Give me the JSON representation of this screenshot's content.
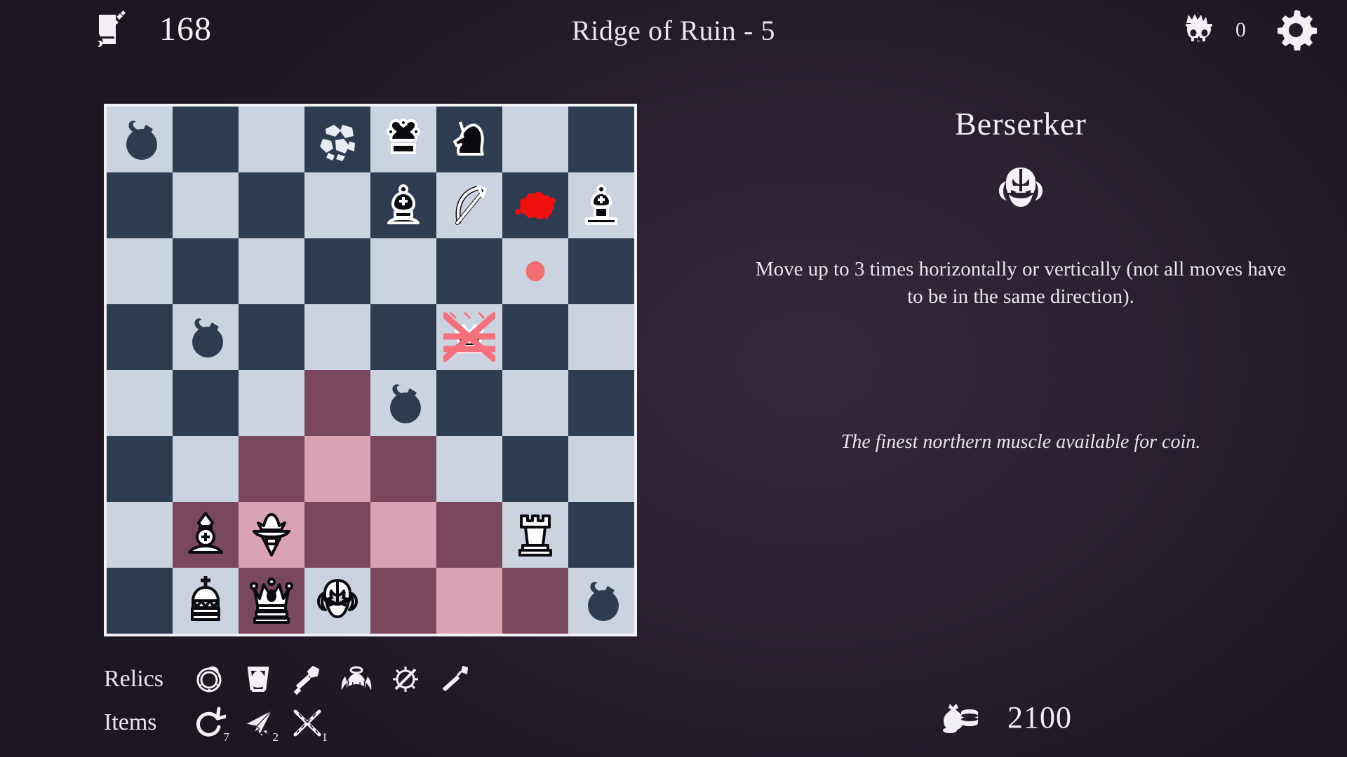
{
  "topbar": {
    "quest_icon": "scroll-icon",
    "quest_count": "168",
    "title": "Ridge of Ruin - 5",
    "skull_icon": "crowned-skull-icon",
    "skull_count": "0",
    "settings_icon": "gear-icon"
  },
  "board": {
    "files": [
      "a",
      "b",
      "c",
      "d",
      "e",
      "f",
      "g",
      "h"
    ],
    "colors": {
      "light": "#ccd3e0",
      "dark": "#2e3c52",
      "highlight_light": "#d9a3b4",
      "highlight_dark": "#79485c",
      "border": "#f2f1f6",
      "blood": "#f01010",
      "dot": "#f07070",
      "chain": "#f4707c"
    },
    "squares": [
      {
        "file": "a",
        "rank": 1,
        "shade": "light",
        "piece": "bomb"
      },
      {
        "file": "b",
        "rank": 1,
        "shade": "dark",
        "piece": null
      },
      {
        "file": "c",
        "rank": 1,
        "shade": "light",
        "piece": null
      },
      {
        "file": "d",
        "rank": 1,
        "shade": "dark",
        "piece": "rubble"
      },
      {
        "file": "e",
        "rank": 1,
        "shade": "light",
        "piece": "black-jester"
      },
      {
        "file": "f",
        "rank": 1,
        "shade": "dark",
        "piece": "black-unicorn"
      },
      {
        "file": "g",
        "rank": 1,
        "shade": "light",
        "piece": null
      },
      {
        "file": "h",
        "rank": 1,
        "shade": "dark",
        "piece": null
      },
      {
        "file": "a",
        "rank": 2,
        "shade": "dark",
        "piece": null
      },
      {
        "file": "b",
        "rank": 2,
        "shade": "light",
        "piece": null
      },
      {
        "file": "c",
        "rank": 2,
        "shade": "dark",
        "piece": null
      },
      {
        "file": "d",
        "rank": 2,
        "shade": "light",
        "piece": null
      },
      {
        "file": "e",
        "rank": 2,
        "shade": "dark",
        "piece": "black-bishop"
      },
      {
        "file": "f",
        "rank": 2,
        "shade": "light",
        "piece": "bow"
      },
      {
        "file": "g",
        "rank": 2,
        "shade": "dark",
        "piece": "blood-splat"
      },
      {
        "file": "h",
        "rank": 2,
        "shade": "light",
        "piece": "black-pawn"
      },
      {
        "file": "a",
        "rank": 3,
        "shade": "light",
        "piece": null
      },
      {
        "file": "b",
        "rank": 3,
        "shade": "dark",
        "piece": null
      },
      {
        "file": "c",
        "rank": 3,
        "shade": "light",
        "piece": null
      },
      {
        "file": "d",
        "rank": 3,
        "shade": "dark",
        "piece": null
      },
      {
        "file": "e",
        "rank": 3,
        "shade": "light",
        "piece": null
      },
      {
        "file": "f",
        "rank": 3,
        "shade": "dark",
        "piece": null
      },
      {
        "file": "g",
        "rank": 3,
        "shade": "light",
        "piece": "red-dot"
      },
      {
        "file": "h",
        "rank": 3,
        "shade": "dark",
        "piece": null
      },
      {
        "file": "a",
        "rank": 4,
        "shade": "dark",
        "piece": null
      },
      {
        "file": "b",
        "rank": 4,
        "shade": "light",
        "piece": "bomb"
      },
      {
        "file": "c",
        "rank": 4,
        "shade": "dark",
        "piece": null
      },
      {
        "file": "d",
        "rank": 4,
        "shade": "light",
        "piece": null
      },
      {
        "file": "e",
        "rank": 4,
        "shade": "dark",
        "piece": null
      },
      {
        "file": "f",
        "rank": 4,
        "shade": "light",
        "piece": "chained-black-queen"
      },
      {
        "file": "g",
        "rank": 4,
        "shade": "dark",
        "piece": null
      },
      {
        "file": "h",
        "rank": 4,
        "shade": "light",
        "piece": null
      },
      {
        "file": "a",
        "rank": 5,
        "shade": "light",
        "piece": null
      },
      {
        "file": "b",
        "rank": 5,
        "shade": "dark",
        "piece": null
      },
      {
        "file": "c",
        "rank": 5,
        "shade": "light",
        "piece": null
      },
      {
        "file": "d",
        "rank": 5,
        "shade": "hl-dark",
        "piece": null
      },
      {
        "file": "e",
        "rank": 5,
        "shade": "light",
        "piece": "bomb"
      },
      {
        "file": "f",
        "rank": 5,
        "shade": "dark",
        "piece": null
      },
      {
        "file": "g",
        "rank": 5,
        "shade": "light",
        "piece": null
      },
      {
        "file": "h",
        "rank": 5,
        "shade": "dark",
        "piece": null
      },
      {
        "file": "a",
        "rank": 6,
        "shade": "dark",
        "piece": null
      },
      {
        "file": "b",
        "rank": 6,
        "shade": "light",
        "piece": null
      },
      {
        "file": "c",
        "rank": 6,
        "shade": "hl-dark",
        "piece": null
      },
      {
        "file": "d",
        "rank": 6,
        "shade": "hl-light",
        "piece": null
      },
      {
        "file": "e",
        "rank": 6,
        "shade": "hl-dark",
        "piece": null
      },
      {
        "file": "f",
        "rank": 6,
        "shade": "light",
        "piece": null
      },
      {
        "file": "g",
        "rank": 6,
        "shade": "dark",
        "piece": null
      },
      {
        "file": "h",
        "rank": 6,
        "shade": "light",
        "piece": null
      },
      {
        "file": "a",
        "rank": 7,
        "shade": "light",
        "piece": null
      },
      {
        "file": "b",
        "rank": 7,
        "shade": "hl-dark",
        "piece": "white-bishop"
      },
      {
        "file": "c",
        "rank": 7,
        "shade": "hl-light",
        "piece": "white-wizard"
      },
      {
        "file": "d",
        "rank": 7,
        "shade": "hl-dark",
        "piece": null
      },
      {
        "file": "e",
        "rank": 7,
        "shade": "hl-light",
        "piece": null
      },
      {
        "file": "f",
        "rank": 7,
        "shade": "hl-dark",
        "piece": null
      },
      {
        "file": "g",
        "rank": 7,
        "shade": "light",
        "piece": "white-rook"
      },
      {
        "file": "h",
        "rank": 7,
        "shade": "dark",
        "piece": null
      },
      {
        "file": "a",
        "rank": 8,
        "shade": "dark",
        "piece": null
      },
      {
        "file": "b",
        "rank": 8,
        "shade": "light",
        "piece": "white-king"
      },
      {
        "file": "c",
        "rank": 8,
        "shade": "hl-dark",
        "piece": "white-queen"
      },
      {
        "file": "d",
        "rank": 8,
        "shade": "light",
        "piece": "white-berserker"
      },
      {
        "file": "e",
        "rank": 8,
        "shade": "hl-dark",
        "piece": null
      },
      {
        "file": "f",
        "rank": 8,
        "shade": "hl-light",
        "piece": null
      },
      {
        "file": "g",
        "rank": 8,
        "shade": "hl-dark",
        "piece": null
      },
      {
        "file": "h",
        "rank": 8,
        "shade": "light",
        "piece": "bomb"
      }
    ]
  },
  "panel": {
    "unit_name": "Berserker",
    "unit_icon": "berserker-helm-icon",
    "description": "Move up to 3 times horizontally or vertically (not all moves have to be in the same direction).",
    "flavor": "The finest northern muscle available for coin."
  },
  "relics": {
    "label": "Relics",
    "items": [
      {
        "icon": "ouroboros-ring-icon"
      },
      {
        "icon": "bell-icon"
      },
      {
        "icon": "scepter-icon"
      },
      {
        "icon": "winged-halo-icon"
      },
      {
        "icon": "slashed-sun-icon"
      },
      {
        "icon": "pickaxe-icon"
      }
    ]
  },
  "items": {
    "label": "Items",
    "entries": [
      {
        "icon": "undo-arrow-icon",
        "count": "7"
      },
      {
        "icon": "paper-dart-icon",
        "count": "2"
      },
      {
        "icon": "crossed-chains-icon",
        "count": "1"
      }
    ]
  },
  "gold": {
    "icon": "coin-bag-icon",
    "amount": "2100"
  }
}
